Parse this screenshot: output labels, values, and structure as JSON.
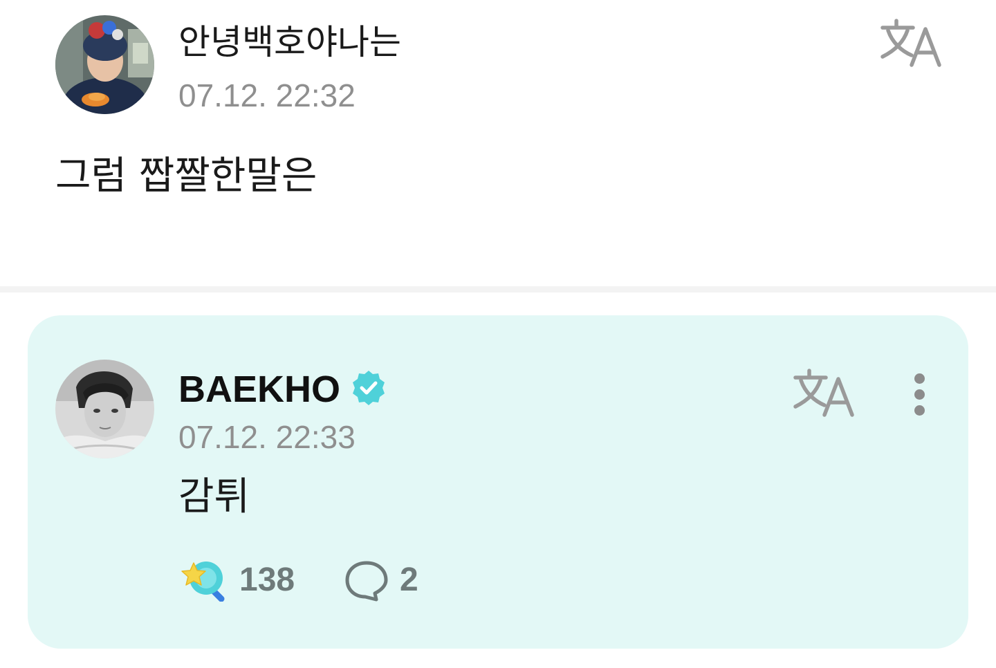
{
  "post": {
    "author": "안녕백호야나는",
    "timestamp": "07.12. 22:32",
    "body": "그럼 짭짤한말은",
    "translate_icon": "translate-icon"
  },
  "reply": {
    "author": "BAEKHO",
    "verified_icon": "verified-badge-icon",
    "timestamp": "07.12. 22:33",
    "body": "감튀",
    "translate_icon": "translate-icon",
    "more_icon": "more-vertical-icon",
    "likes": "138",
    "like_icon": "star-wand-like-icon",
    "comments": "2",
    "comment_icon": "speech-bubble-icon"
  },
  "colors": {
    "card_background": "#e3f8f6",
    "accent": "#4fd1d9",
    "timestamp": "#8f8f8f",
    "icon_gray": "#8c8c8c"
  }
}
